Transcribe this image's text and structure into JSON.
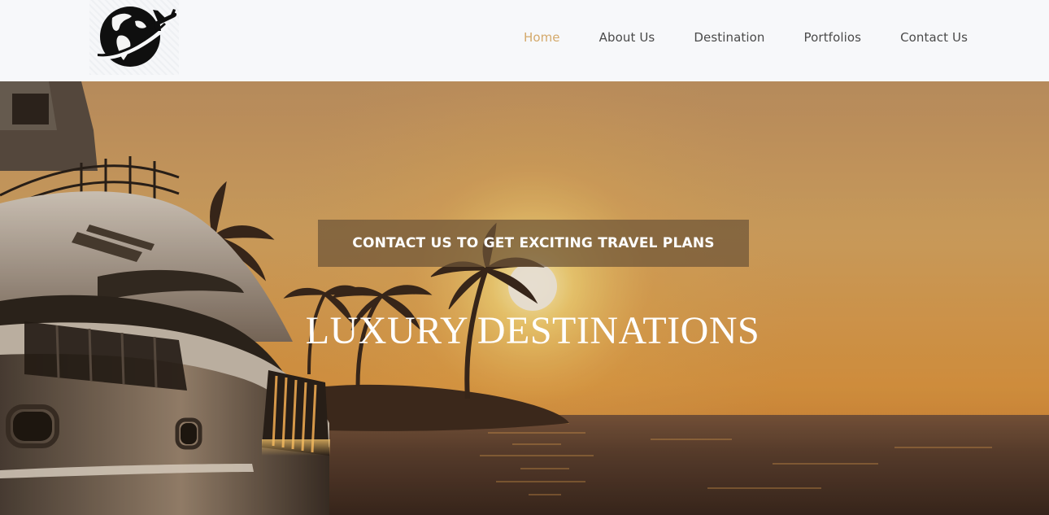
{
  "brand": {
    "logo_icon": "globe-airplane-icon"
  },
  "nav": {
    "items": [
      {
        "label": "Home",
        "active": true
      },
      {
        "label": "About Us",
        "active": false
      },
      {
        "label": "Destination",
        "active": false
      },
      {
        "label": "Portfolios",
        "active": false
      },
      {
        "label": "Contact Us",
        "active": false
      }
    ]
  },
  "hero": {
    "cta_label": "CONTACT US TO GET EXCITING TRAVEL PLANS",
    "title": "LUXURY DESTINATIONS",
    "background": "sunset-yacht-palm-island-scene"
  },
  "colors": {
    "nav_bg": "#f7f8fa",
    "nav_active": "#d4a96b",
    "nav_text": "#4a4a4a",
    "cta_bg": "#6e5537",
    "hero_text": "#ffffff"
  }
}
